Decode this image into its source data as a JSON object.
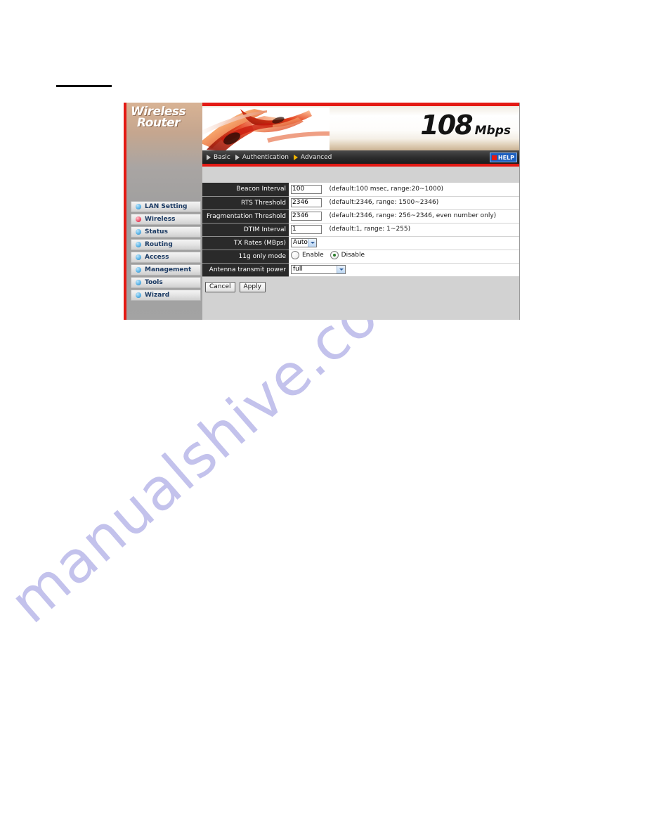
{
  "page": {
    "watermark": "manualshive.com"
  },
  "device": {
    "brand_line1": "Wireless",
    "brand_line2": "Router",
    "speed_number": "108",
    "speed_unit": "Mbps"
  },
  "sidebar": {
    "items": [
      {
        "label": "LAN Setting",
        "active": false
      },
      {
        "label": "Wireless",
        "active": true
      },
      {
        "label": "Status",
        "active": false
      },
      {
        "label": "Routing",
        "active": false
      },
      {
        "label": "Access",
        "active": false
      },
      {
        "label": "Management",
        "active": false
      },
      {
        "label": "Tools",
        "active": false
      },
      {
        "label": "Wizard",
        "active": false
      }
    ]
  },
  "navbar": {
    "tabs": [
      {
        "label": "Basic",
        "active": false
      },
      {
        "label": "Authentication",
        "active": false
      },
      {
        "label": "Advanced",
        "active": true
      }
    ],
    "help_label": "HELP"
  },
  "form": {
    "rows": [
      {
        "label": "Beacon Interval",
        "control": "text",
        "value": "100",
        "hint": "(default:100 msec, range:20~1000)"
      },
      {
        "label": "RTS Threshold",
        "control": "text",
        "value": "2346",
        "hint": "(default:2346, range: 1500~2346)"
      },
      {
        "label": "Fragmentation Threshold",
        "control": "text",
        "value": "2346",
        "hint": "(default:2346, range: 256~2346, even number only)"
      },
      {
        "label": "DTIM Interval",
        "control": "text",
        "value": "1",
        "hint": "(default:1, range: 1~255)"
      },
      {
        "label": "TX Rates (MBps)",
        "control": "select-small",
        "value": "Auto",
        "hint": ""
      },
      {
        "label": "11g only mode",
        "control": "radio",
        "options": [
          {
            "label": "Enable",
            "checked": false
          },
          {
            "label": "Disable",
            "checked": true
          }
        ],
        "hint": ""
      },
      {
        "label": "Antenna transmit power",
        "control": "select-wide",
        "value": "full",
        "hint": ""
      }
    ]
  },
  "buttons": {
    "cancel": "Cancel",
    "apply": "Apply"
  },
  "colors": {
    "accent_red": "#e41a14",
    "label_bg": "#2a2a2a",
    "help_blue": "#1d5fbe",
    "watermark": "#c3c2ec"
  }
}
